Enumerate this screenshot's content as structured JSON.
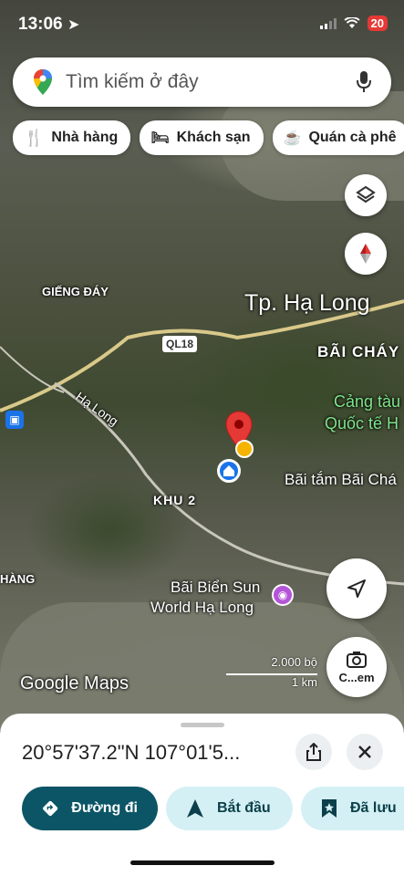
{
  "status": {
    "time": "13:06",
    "battery": "20"
  },
  "search": {
    "placeholder": "Tìm kiếm ở đây"
  },
  "chips": [
    {
      "label": "Nhà hàng",
      "icon": "restaurant-icon"
    },
    {
      "label": "Khách sạn",
      "icon": "hotel-icon"
    },
    {
      "label": "Quán cà phê",
      "icon": "cafe-icon"
    }
  ],
  "map": {
    "labels": {
      "gieng_day": "GIẾNG ĐÁY",
      "city": "Tp. Hạ Long",
      "road": "QL18",
      "bai_chay": "BÃI CHÁY",
      "cang_tau_1": "Cảng tàu",
      "cang_tau_2": "Quốc tế H",
      "ha_long_road": "Hạ Long",
      "bai_tam": "Bãi tắm Bãi Chá",
      "khu2": "KHU 2",
      "hang": "HÀNG",
      "sun_1": "Bãi Biển Sun",
      "sun_2": "World Hạ Long",
      "brand": "Google Maps",
      "scale_top": "2.000 bộ",
      "scale_bottom": "1 km",
      "camera_label": "C...em"
    }
  },
  "sheet": {
    "coords": "20°57'37.2\"N 107°01'5...",
    "buttons": [
      {
        "label": "Đường đi"
      },
      {
        "label": "Bắt đầu"
      },
      {
        "label": "Đã lưu"
      }
    ]
  },
  "colors": {
    "primary": "#0b5566",
    "accent_light": "#d4f0f5",
    "pin_red": "#e53935"
  }
}
